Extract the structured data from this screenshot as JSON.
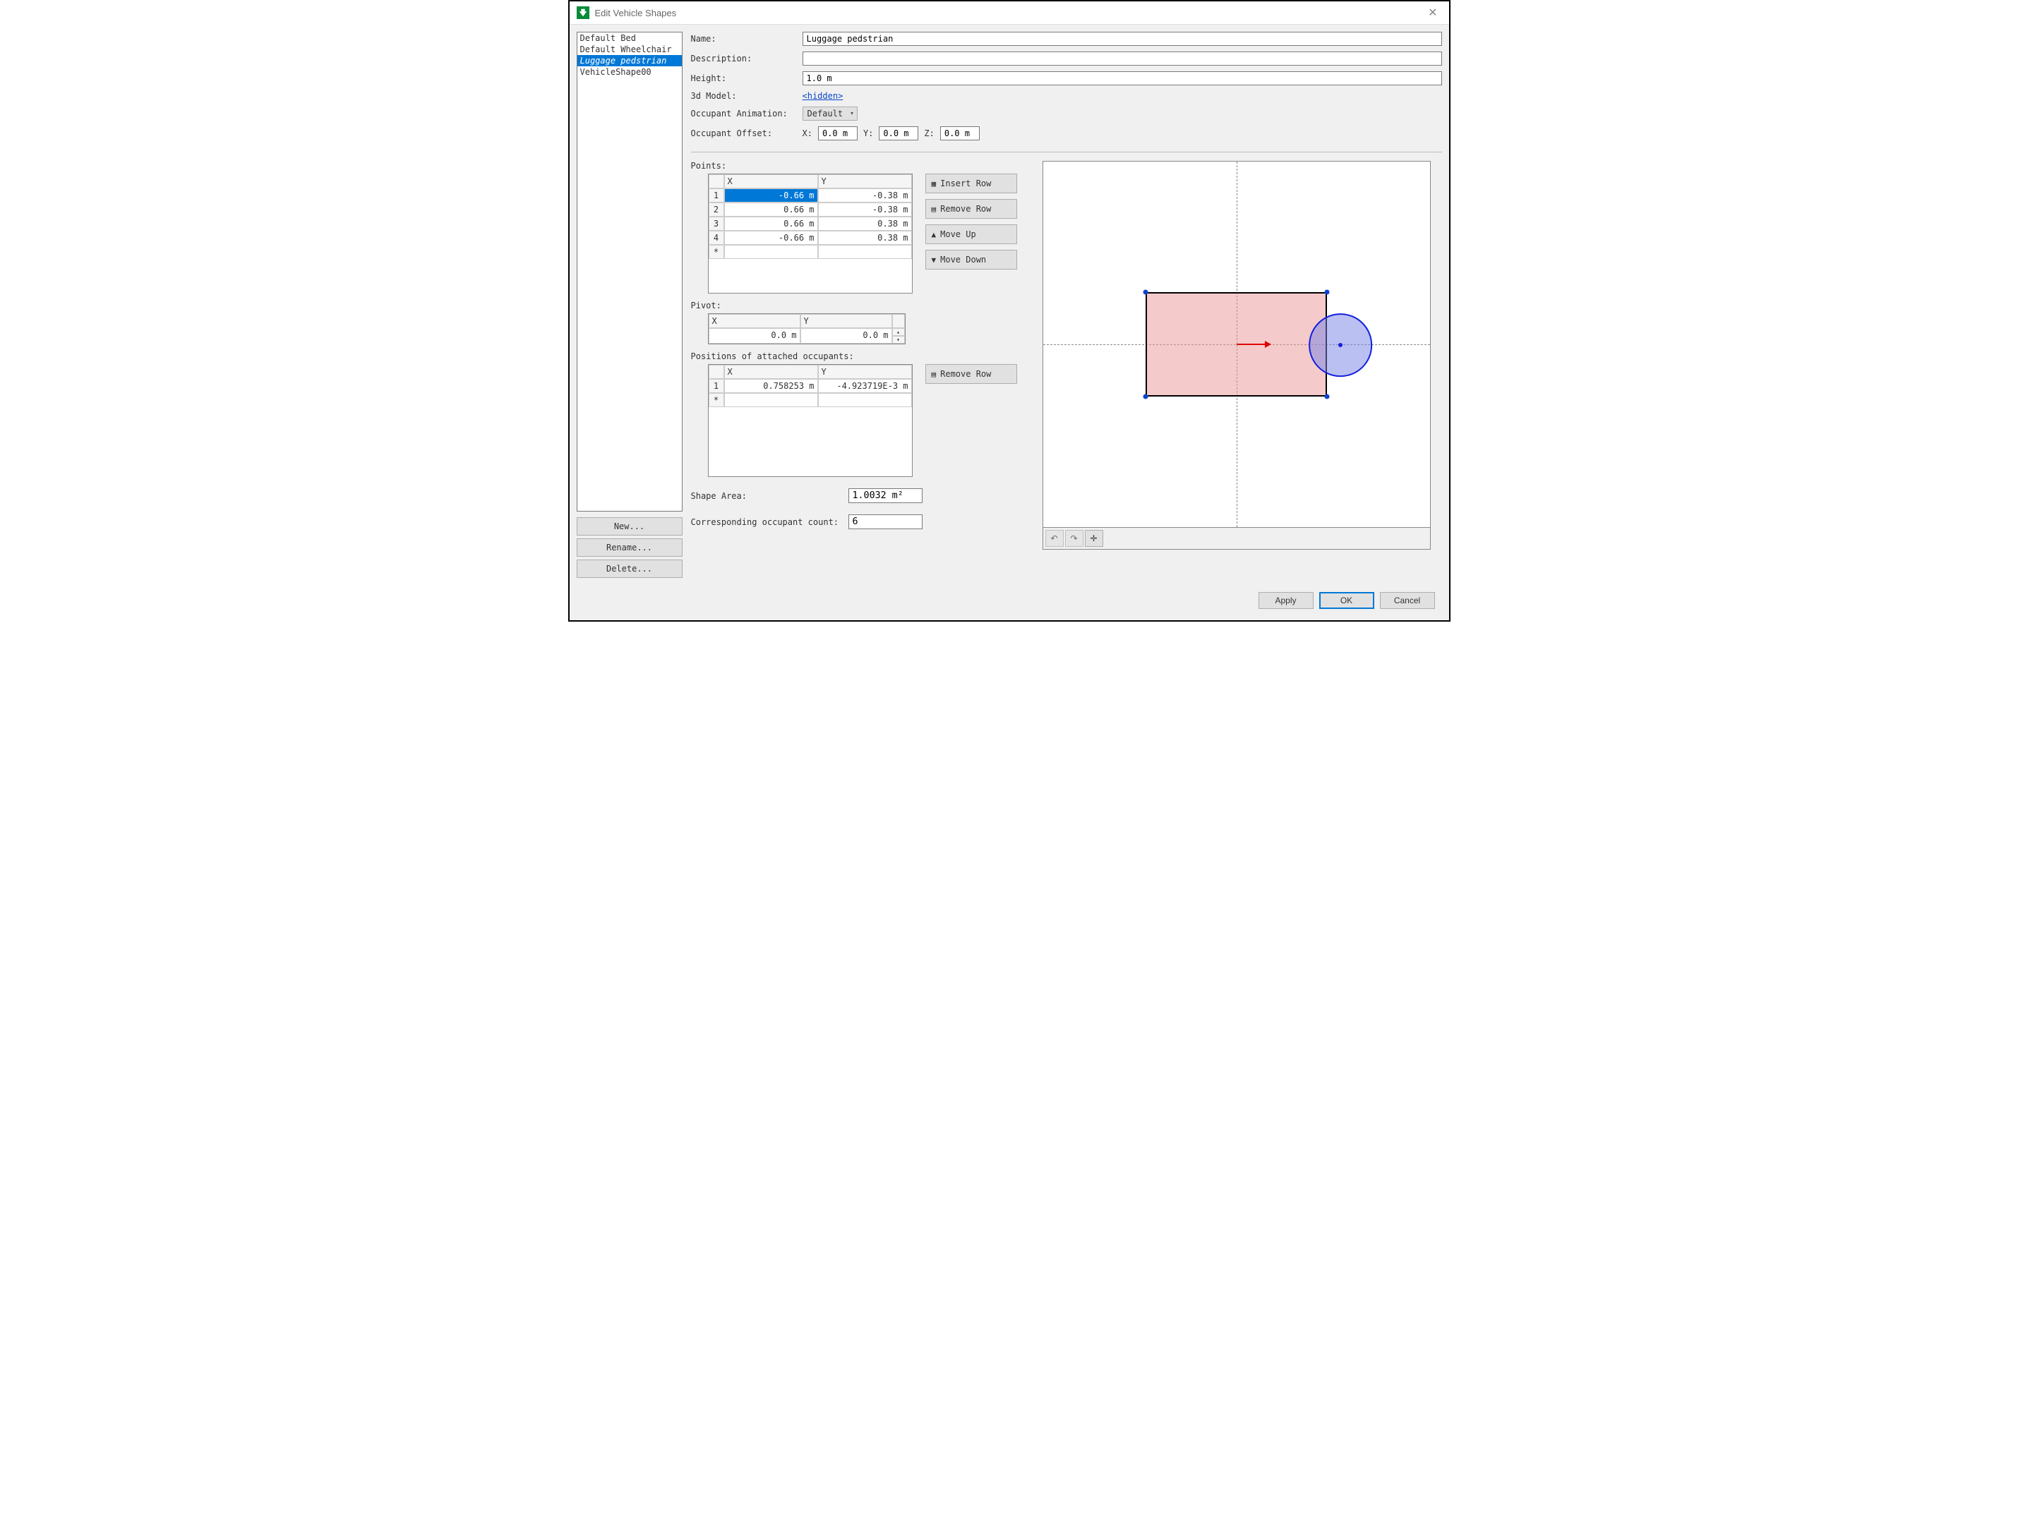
{
  "window": {
    "title": "Edit Vehicle Shapes",
    "close_glyph": "✕"
  },
  "shapes_list": {
    "items": [
      "Default Bed",
      "Default Wheelchair",
      "Luggage pedstrian",
      "VehicleShape00"
    ],
    "selected_index": 2
  },
  "sidebar_buttons": {
    "new": "New...",
    "rename": "Rename...",
    "delete": "Delete..."
  },
  "fields": {
    "name_label": "Name:",
    "name_value": "Luggage pedstrian",
    "description_label": "Description:",
    "description_value": "",
    "height_label": "Height:",
    "height_value": "1.0 m",
    "model_label": "3d Model:",
    "model_link": "<hidden>",
    "anim_label": "Occupant Animation:",
    "anim_value": "Default",
    "offset_label": "Occupant Offset:",
    "offset_x_label": "X:",
    "offset_x": "0.0 m",
    "offset_y_label": "Y:",
    "offset_y": "0.0 m",
    "offset_z_label": "Z:",
    "offset_z": "0.0 m"
  },
  "points": {
    "label": "Points:",
    "headers": {
      "x": "X",
      "y": "Y"
    },
    "rows": [
      {
        "n": "1",
        "x": "-0.66 m",
        "y": "-0.38 m",
        "selected": true
      },
      {
        "n": "2",
        "x": "0.66 m",
        "y": "-0.38 m"
      },
      {
        "n": "3",
        "x": "0.66 m",
        "y": "0.38 m"
      },
      {
        "n": "4",
        "x": "-0.66 m",
        "y": "0.38 m"
      }
    ],
    "new_row_marker": "*",
    "buttons": {
      "insert": "Insert Row",
      "remove": "Remove Row",
      "up": "Move Up",
      "down": "Move Down"
    }
  },
  "pivot": {
    "label": "Pivot:",
    "headers": {
      "x": "X",
      "y": "Y"
    },
    "row": {
      "x": "0.0 m",
      "y": "0.0 m"
    }
  },
  "occupants": {
    "label": "Positions of attached occupants:",
    "headers": {
      "x": "X",
      "y": "Y"
    },
    "rows": [
      {
        "n": "1",
        "x": "0.758253 m",
        "y": "-4.923719E-3 m"
      }
    ],
    "new_row_marker": "*",
    "remove_button": "Remove Row"
  },
  "stats": {
    "area_label": "Shape Area:",
    "area_value": "1.0032 m²",
    "count_label": "Corresponding occupant count:",
    "count_value": "6"
  },
  "dialog_buttons": {
    "apply": "Apply",
    "ok": "OK",
    "cancel": "Cancel"
  },
  "chart_data": {
    "type": "shape-preview",
    "units": "m",
    "title": "",
    "axes": {
      "origin": [
        0,
        0
      ],
      "grid": true
    },
    "polygon": [
      [
        -0.66,
        -0.38
      ],
      [
        0.66,
        -0.38
      ],
      [
        0.66,
        0.38
      ],
      [
        -0.66,
        0.38
      ]
    ],
    "pivot": [
      0.0,
      0.0
    ],
    "direction_arrow": {
      "from": [
        0.0,
        0.0
      ],
      "to": [
        0.25,
        0.0
      ]
    },
    "occupants": [
      {
        "center": [
          0.758253,
          -0.004923719
        ],
        "radius": 0.23
      }
    ]
  }
}
